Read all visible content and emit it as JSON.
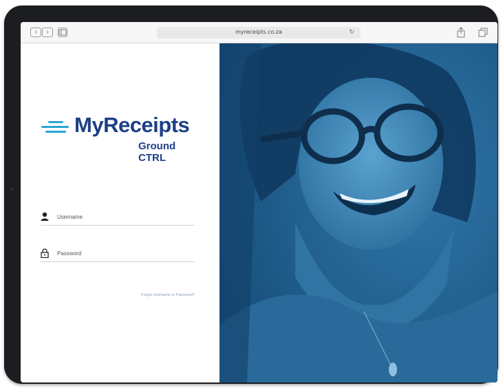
{
  "browser": {
    "url": "myreceipts.co.za",
    "back_icon": "chevron-left-icon",
    "forward_icon": "chevron-right-icon",
    "sidebar_icon": "sidebar-icon",
    "reload_icon": "reload-icon",
    "share_icon": "share-icon",
    "tabs_icon": "tabs-icon"
  },
  "brand": {
    "name": "MyReceipts",
    "subtitle": "Ground CTRL",
    "colors": {
      "primary": "#1c3f86",
      "accent": "#28a6d4",
      "photo_tint": "#1f5d8c"
    }
  },
  "login": {
    "username_placeholder": "Username",
    "username_icon": "user-icon",
    "password_placeholder": "Password",
    "password_icon": "lock-icon",
    "forgot_link": "Forgot Username or Password?"
  }
}
